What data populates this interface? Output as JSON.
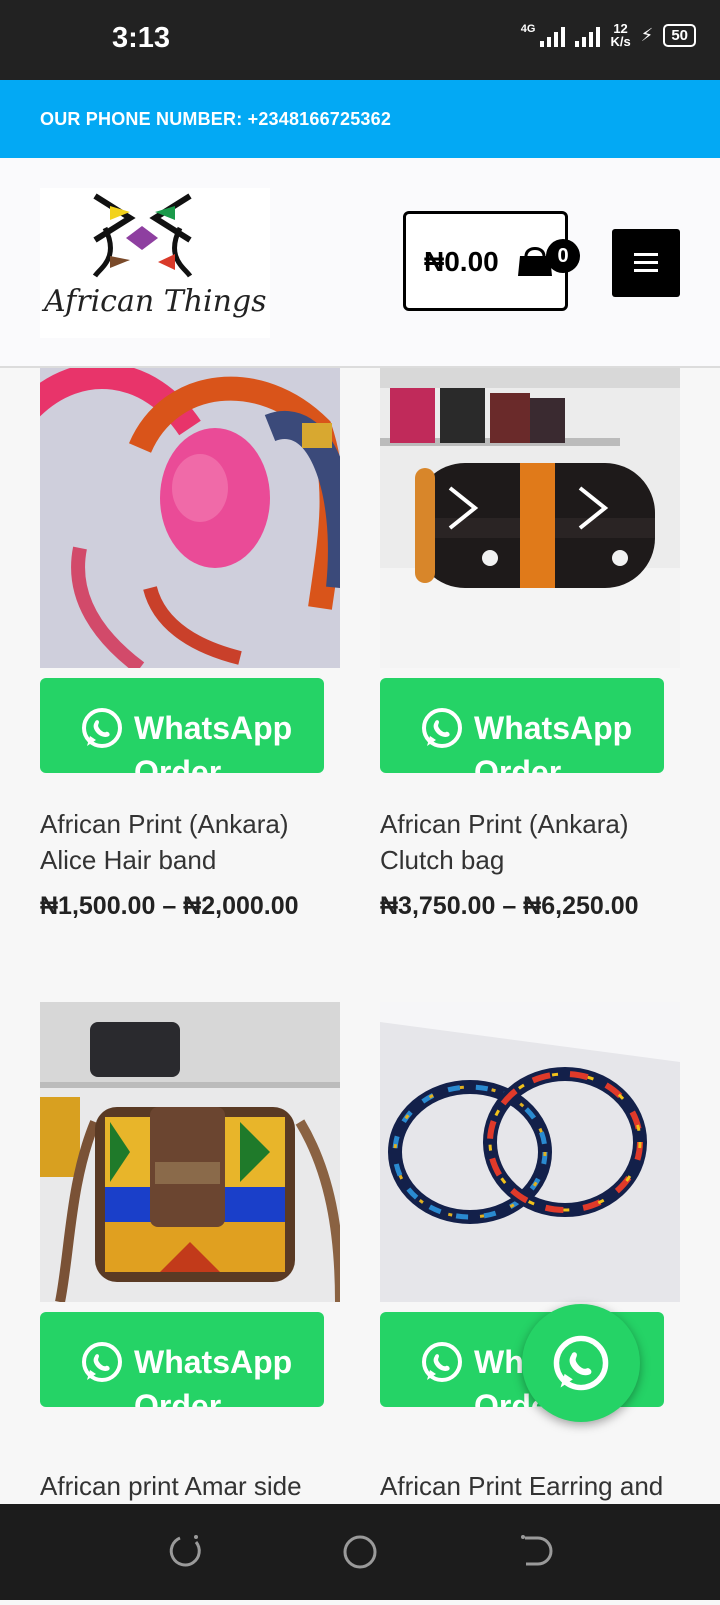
{
  "status_bar": {
    "time": "3:13",
    "network": "4G",
    "speed_value": "12",
    "speed_unit": "K/s",
    "battery": "50"
  },
  "top_bar": {
    "phone_text": "OUR PHONE NUMBER: +2348166725362"
  },
  "header": {
    "logo_text": "African Things",
    "cart_total": "₦0.00",
    "cart_count": "0",
    "menu_icon": "hamburger-icon"
  },
  "products": [
    {
      "title": "African Print (Ankara) Alice Hair band",
      "price": "₦1,500.00 – ₦2,000.00",
      "button": "WhatsApp Order"
    },
    {
      "title": "African Print (Ankara) Clutch bag",
      "price": "₦3,750.00 – ₦6,250.00",
      "button": "WhatsApp Order"
    },
    {
      "title": "African print Amar side",
      "button": "WhatsApp Order"
    },
    {
      "title": "African Print Earring and",
      "button": "WhatsApp Order"
    }
  ],
  "colors": {
    "accent_blue": "#03a9f4",
    "whatsapp_green": "#25d366",
    "status_bar": "#222222"
  }
}
